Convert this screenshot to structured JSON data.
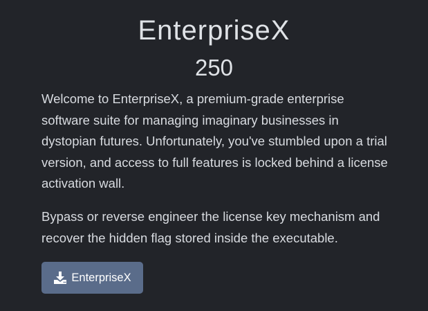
{
  "challenge": {
    "title": "EnterpriseX",
    "points": "250",
    "description": [
      "Welcome to EnterpriseX, a premium-grade enterprise software suite for managing imaginary businesses in dystopian futures. Unfortunately, you've stumbled upon a trial version, and access to full features is locked behind a license activation wall.",
      "Bypass or reverse engineer the license key mechanism and recover the hidden flag stored inside the executable."
    ],
    "download": {
      "label": "EnterpriseX",
      "icon": "download-icon"
    }
  },
  "colors": {
    "background": "#222429",
    "button": "#5a6c8a",
    "text": "#d8dbe0"
  }
}
